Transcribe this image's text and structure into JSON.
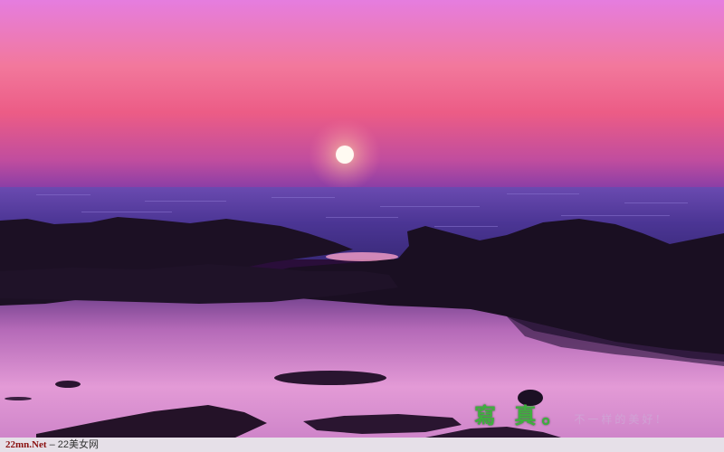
{
  "photo": {
    "subject": "sunset-over-rocky-sea-shore",
    "colors": {
      "sky_top": "#e07ce0",
      "sky_mid": "#f06a9a",
      "sky_horizon": "#b44aa8",
      "sea": "#4a3a9a",
      "rocks": "#1a0f22",
      "pool": "#d98ad0",
      "sun": "#fff8f0"
    }
  },
  "watermark": {
    "main": "寫 真",
    "dot": "。",
    "slogan": "不一样的美好!"
  },
  "footer": {
    "site_url": "22mn.Net",
    "separator": " – ",
    "site_name": "22美女网"
  }
}
